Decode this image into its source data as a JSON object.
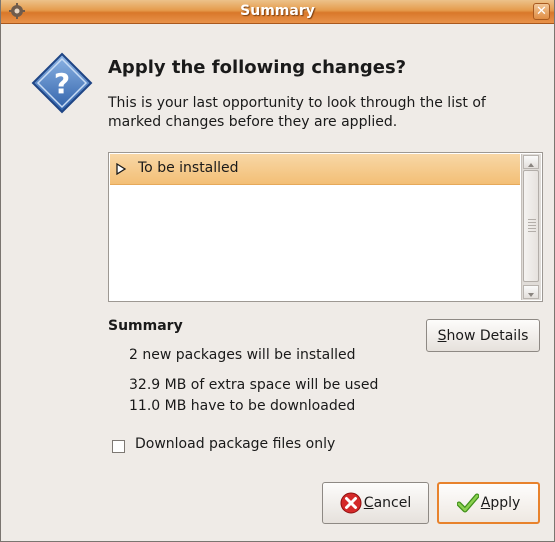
{
  "window": {
    "title": "Summary",
    "close_label": "✕"
  },
  "heading": "Apply the following changes?",
  "description": "This is your last opportunity to look through the list of marked changes before they are applied.",
  "changes_list": {
    "rows": [
      {
        "label": "To be installed",
        "expanded": false
      }
    ]
  },
  "summary": {
    "title": "Summary",
    "lines": [
      "2 new packages will be installed",
      "32.9 MB of extra space will be used",
      "11.0 MB have to be downloaded"
    ],
    "show_details_mnemonic": "S",
    "show_details_rest": "how Details"
  },
  "download_only": {
    "label": "Download package files only",
    "checked": false
  },
  "buttons": {
    "cancel_mnemonic": "C",
    "cancel_rest": "ancel",
    "apply_mnemonic": "A",
    "apply_rest": "pply"
  },
  "colors": {
    "titlebar": "#e59b4c",
    "selection": "#f3bf76",
    "default_button_border": "#e8822c"
  },
  "icons": {
    "title": "synaptic-icon",
    "dialog": "question-icon",
    "cancel": "cancel-icon",
    "apply": "checkmark-icon"
  }
}
